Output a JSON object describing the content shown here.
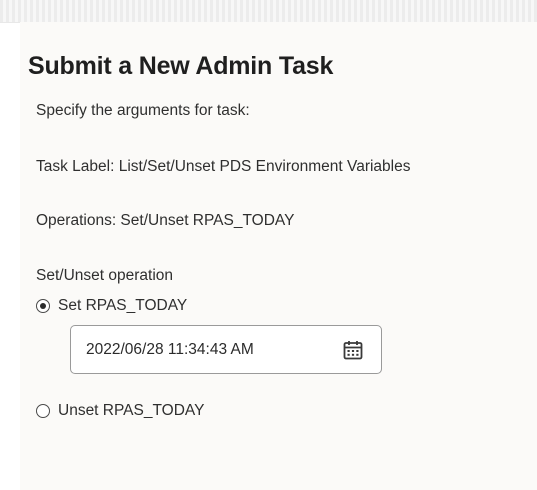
{
  "page": {
    "title": "Submit a New Admin Task",
    "intro": "Specify the arguments for task:",
    "task_label": "Task Label: List/Set/Unset PDS Environment Variables",
    "operations": "Operations: Set/Unset RPAS_TODAY"
  },
  "operation_group": {
    "label": "Set/Unset operation",
    "options": [
      {
        "label": "Set RPAS_TODAY",
        "selected": true
      },
      {
        "label": "Unset RPAS_TODAY",
        "selected": false
      }
    ]
  },
  "datetime_field": {
    "value": "2022/06/28 11:34:43 AM",
    "icon": "calendar-icon"
  },
  "colors": {
    "panel_background": "#fbfaf8",
    "text": "#2f2f2f",
    "border": "#9a9a9a"
  }
}
